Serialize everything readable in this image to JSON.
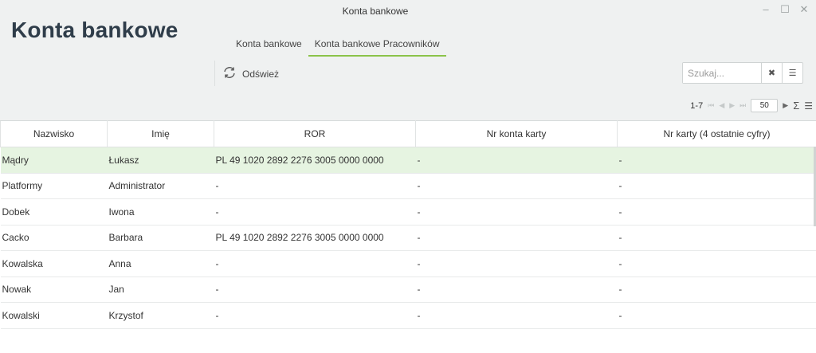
{
  "window": {
    "title": "Konta bankowe",
    "controls": [
      "–",
      "☐",
      "✕"
    ]
  },
  "page": {
    "title": "Konta bankowe"
  },
  "tabs": [
    {
      "label": "Konta bankowe",
      "active": false
    },
    {
      "label": "Konta bankowe Pracowników",
      "active": true
    }
  ],
  "toolbar": {
    "refresh_label": "Odśwież"
  },
  "search": {
    "placeholder": "Szukaj...",
    "value": ""
  },
  "pager": {
    "range": "1-7",
    "page_size": "50"
  },
  "colors": {
    "accent": "#8bc34a",
    "selected_row": "#e6f4e1",
    "header_bg": "#eff1f1"
  },
  "table": {
    "columns": [
      "Nazwisko",
      "Imię",
      "ROR",
      "Nr konta karty",
      "Nr karty (4 ostatnie cyfry)"
    ],
    "rows": [
      [
        "Mądry",
        "Łukasz",
        "PL 49 1020 2892 2276 3005 0000 0000",
        "-",
        "-"
      ],
      [
        "Platformy",
        "Administrator",
        "-",
        "-",
        "-"
      ],
      [
        "Dobek",
        "Iwona",
        "-",
        "-",
        "-"
      ],
      [
        "Cacko",
        "Barbara",
        "PL 49 1020 2892 2276 3005 0000 0000",
        "-",
        "-"
      ],
      [
        "Kowalska",
        "Anna",
        "-",
        "-",
        "-"
      ],
      [
        "Nowak",
        "Jan",
        "-",
        "-",
        "-"
      ],
      [
        "Kowalski",
        "Krzystof",
        "-",
        "-",
        "-"
      ]
    ],
    "selected_row": 0
  }
}
